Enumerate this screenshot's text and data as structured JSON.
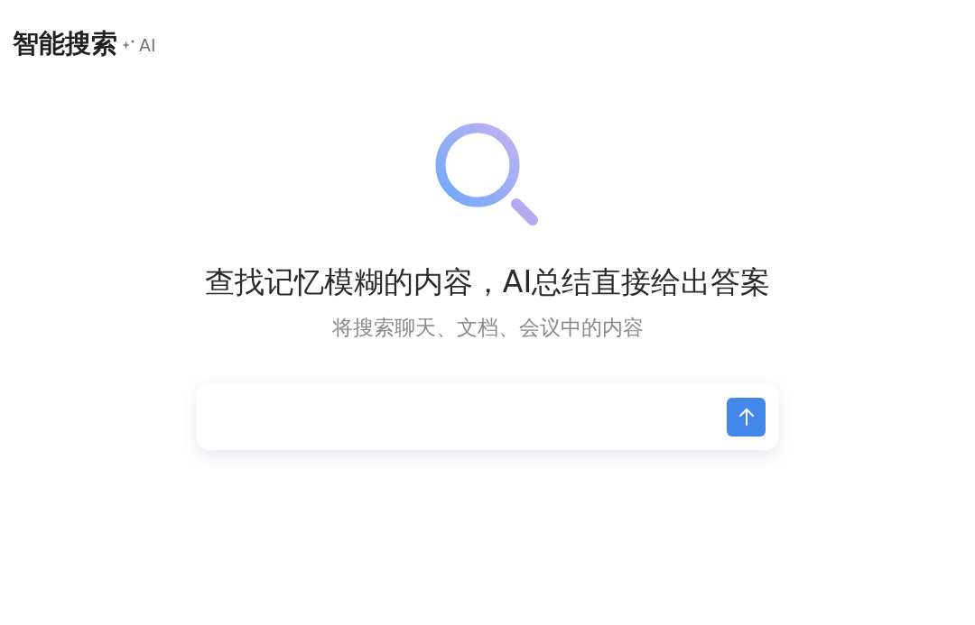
{
  "header": {
    "title": "智能搜索",
    "badge": "AI"
  },
  "hero": {
    "heading": "查找记忆模糊的内容，AI总结直接给出答案",
    "subheading": "将搜索聊天、文档、会议中的内容"
  },
  "search": {
    "send_disabled": false
  }
}
